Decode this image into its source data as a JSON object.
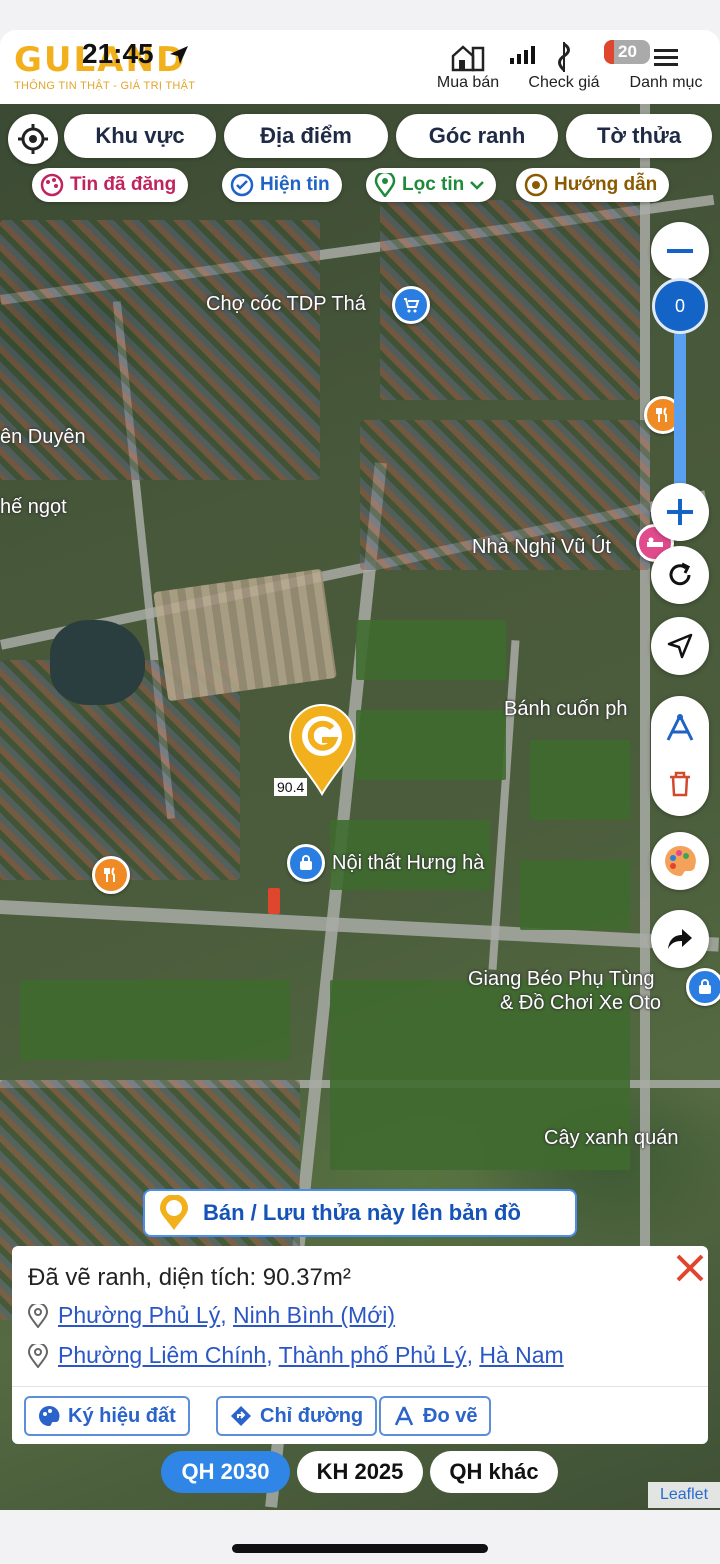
{
  "status_bar": {
    "time": "21:45",
    "battery": "20"
  },
  "brand": {
    "logo": "GULAND",
    "tagline": "THÔNG TIN THẬT - GIÁ TRỊ THẬT"
  },
  "top_nav": [
    {
      "label": "Mua bán",
      "icon": "building-icon"
    },
    {
      "label": "Check giá",
      "icon": "price-tag-icon"
    },
    {
      "label": "Danh mục",
      "icon": "menu-icon"
    }
  ],
  "search_chips": [
    "Khu vực",
    "Địa điểm",
    "Góc ranh",
    "Tờ thửa"
  ],
  "filter_pills": [
    {
      "label": "Tin đã đăng",
      "color": "#c0245c",
      "icon": "palette-icon"
    },
    {
      "label": "Hiện tin",
      "color": "#1e63c6",
      "icon": "check-circle-icon"
    },
    {
      "label": "Lọc tin",
      "color": "#1f8a3a",
      "icon": "location-pin-icon"
    },
    {
      "label": "Hướng dẫn",
      "color": "#8a5a00",
      "icon": "guide-icon"
    }
  ],
  "zoom_slider": {
    "value": "0"
  },
  "map_labels": {
    "market": "Chợ cóc TDP Thá",
    "duyen": "ên Duyên",
    "ngot": "hế ngọt",
    "nha_nghi": "Nhà Nghỉ Vũ Út",
    "banh_cuon": "Bánh cuốn ph",
    "noi_that": "Nội thất Hưng hà",
    "giang_beo_1": "Giang Béo Phụ Tùng",
    "giang_beo_2": "& Đồ Chơi Xe Oto",
    "cay_xanh": "Cây xanh quán",
    "plot_value": "90.4"
  },
  "save_banner": {
    "label": "Bán / Lưu thửa này lên bản đồ"
  },
  "info_panel": {
    "area_text": "Đã vẽ ranh, diện tích: 90.37m²",
    "address_new": {
      "ward": "Phường Phủ Lý",
      "province": "Ninh Bình (Mới)"
    },
    "address_old": {
      "ward": "Phường Liêm Chính",
      "city": "Thành phố Phủ Lý",
      "province": "Hà Nam"
    },
    "actions": [
      "Ký hiệu đất",
      "Chỉ đường",
      "Đo vẽ"
    ]
  },
  "plan_tabs": [
    {
      "label": "QH 2030",
      "active": true
    },
    {
      "label": "KH 2025",
      "active": false
    },
    {
      "label": "QH khác",
      "active": false
    }
  ],
  "attribution": "Leaflet",
  "colors": {
    "accent": "#1e7be0",
    "brand": "#f2b11c",
    "close": "#e0452e"
  }
}
